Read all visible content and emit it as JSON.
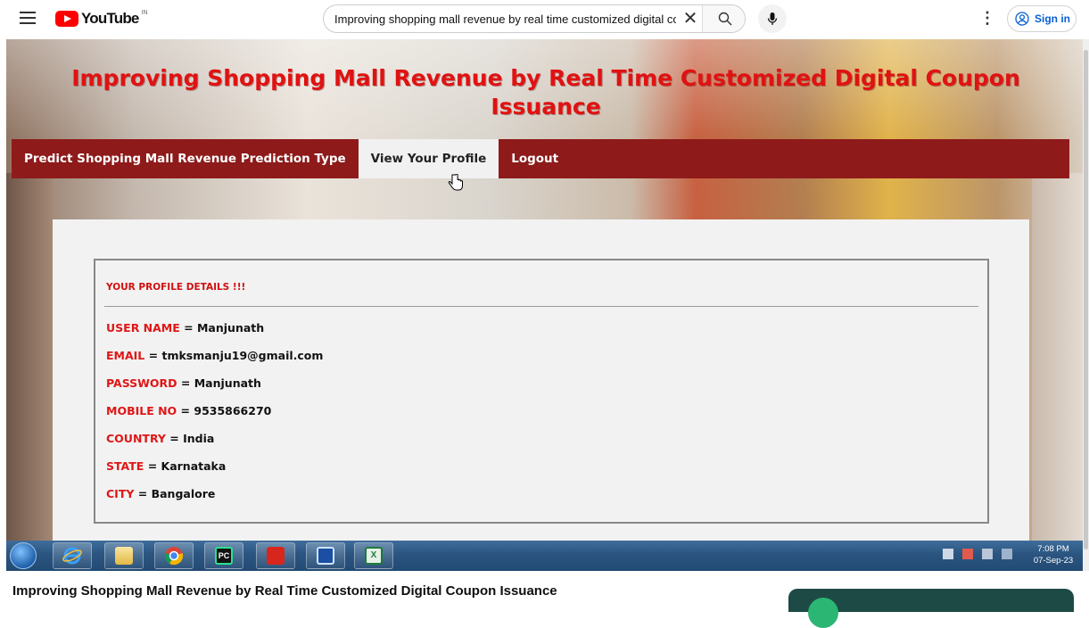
{
  "youtube": {
    "logo_text": "YouTube",
    "country": "IN",
    "search_value": "Improving shopping mall revenue by real time customized digital coupon issuance",
    "sign_in": "Sign in"
  },
  "page": {
    "headline": "Improving Shopping Mall Revenue by Real Time Customized Digital Coupon Issuance",
    "nav": [
      {
        "label": "Predict Shopping Mall Revenue Prediction Type"
      },
      {
        "label": "View Your Profile"
      },
      {
        "label": "Logout"
      }
    ],
    "profile_heading": "YOUR PROFILE DETAILS !!!",
    "fields": [
      {
        "label": "USER NAME",
        "value": "= Manjunath"
      },
      {
        "label": "EMAIL",
        "value": "= tmksmanju19@gmail.com"
      },
      {
        "label": "PASSWORD",
        "value": "= Manjunath"
      },
      {
        "label": "MOBILE NO",
        "value": "= 9535866270"
      },
      {
        "label": "COUNTRY",
        "value": "= India"
      },
      {
        "label": "STATE",
        "value": "= Karnataka"
      },
      {
        "label": "CITY",
        "value": "= Bangalore"
      }
    ]
  },
  "taskbar": {
    "time": "7:08 PM",
    "date": "07-Sep-23",
    "apps": [
      "internet-explorer-icon",
      "file-explorer-icon",
      "chrome-icon",
      "pycharm-icon",
      "acrobat-icon",
      "remote-desktop-icon",
      "excel-icon"
    ]
  },
  "video": {
    "title": "Improving Shopping Mall Revenue by Real Time Customized Digital Coupon Issuance"
  },
  "colors": {
    "nav_bg": "#8e1a1a",
    "headline_red": "#e01212",
    "label_red": "#e01616",
    "youtube_red": "#ff0000",
    "signin_blue": "#065fd4"
  }
}
